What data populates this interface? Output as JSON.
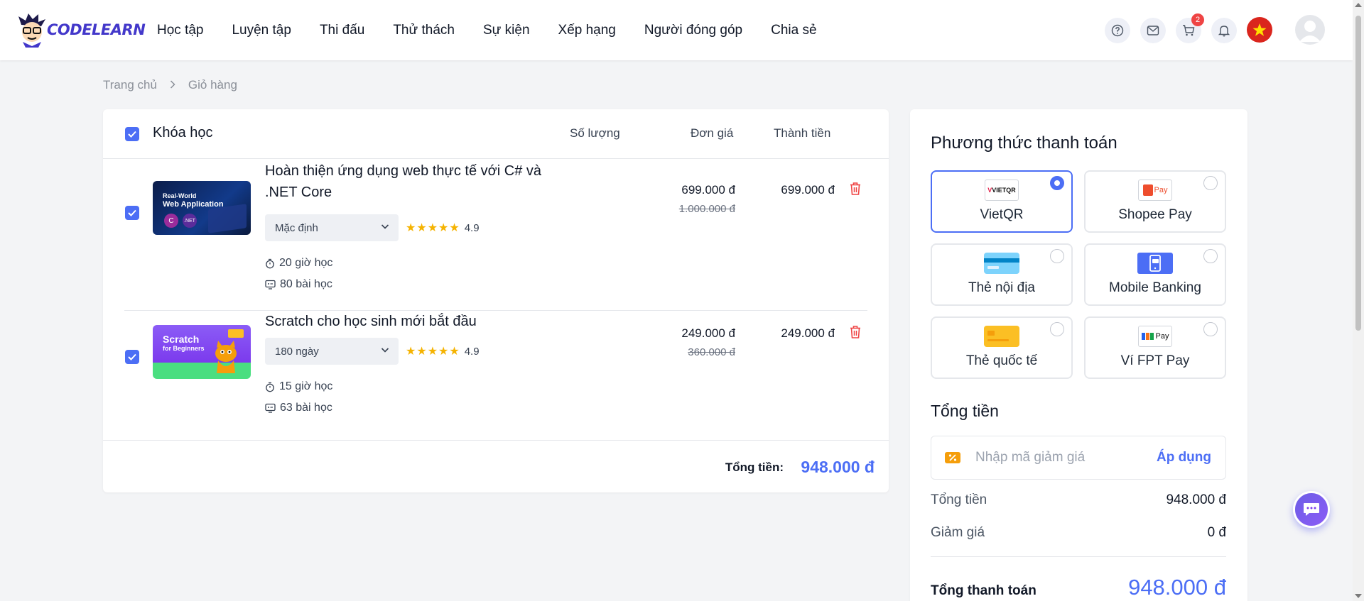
{
  "brand": {
    "name": "CODELEARN",
    "accent": "#4c6ef5"
  },
  "nav": [
    "Học tập",
    "Luyện tập",
    "Thi đấu",
    "Thử thách",
    "Sự kiện",
    "Xếp hạng",
    "Người đóng góp",
    "Chia sẻ"
  ],
  "header": {
    "cart_count": "2",
    "icons": [
      "help-icon",
      "mail-icon",
      "cart-icon",
      "bell-icon",
      "vietnam-flag-icon",
      "avatar"
    ]
  },
  "breadcrumb": {
    "home": "Trang chủ",
    "current": "Giỏ hàng"
  },
  "cart": {
    "headers": {
      "course": "Khóa học",
      "quantity": "Số lượng",
      "unit_price": "Đơn giá",
      "total": "Thành tiền"
    },
    "items": [
      {
        "title": "Hoàn thiện ứng dụng web thực tế với C# và .NET Core",
        "thumb_line1": "Real-World",
        "thumb_line2": "Web Application",
        "thumb_badge1": "C",
        "thumb_badge2": ".NET",
        "option": "Mặc định",
        "rating": "4.9",
        "hours": "20 giờ học",
        "lessons": "80 bài học",
        "price": "699.000 đ",
        "old_price": "1.000.000 đ",
        "line_total": "699.000 đ"
      },
      {
        "title": "Scratch cho học sinh mới bắt đầu",
        "thumb_line1": "Scratch",
        "thumb_line2": "for Beginners",
        "option": "180 ngày",
        "rating": "4.9",
        "hours": "15 giờ học",
        "lessons": "63 bài học",
        "price": "249.000 đ",
        "old_price": "360.000 đ",
        "line_total": "249.000 đ"
      }
    ],
    "footer_label": "Tổng tiền:",
    "footer_value": "948.000 đ"
  },
  "payment": {
    "title": "Phương thức thanh toán",
    "methods": [
      {
        "label": "VietQR",
        "logo_text": "VIETQR",
        "selected": true
      },
      {
        "label": "Shopee Pay",
        "logo_text": "Pay",
        "selected": false
      },
      {
        "label": "Thẻ nội địa",
        "selected": false
      },
      {
        "label": "Mobile Banking",
        "selected": false
      },
      {
        "label": "Thẻ quốc tế",
        "selected": false
      },
      {
        "label": "Ví FPT Pay",
        "logo_text": "Pay",
        "selected": false
      }
    ]
  },
  "summary": {
    "title": "Tổng tiền",
    "coupon_placeholder": "Nhập mã giảm giá",
    "apply_label": "Áp dụng",
    "subtotal_label": "Tổng tiền",
    "subtotal_value": "948.000 đ",
    "discount_label": "Giảm giá",
    "discount_value": "0 đ",
    "grand_label": "Tổng thanh toán",
    "grand_value": "948.000 đ"
  }
}
